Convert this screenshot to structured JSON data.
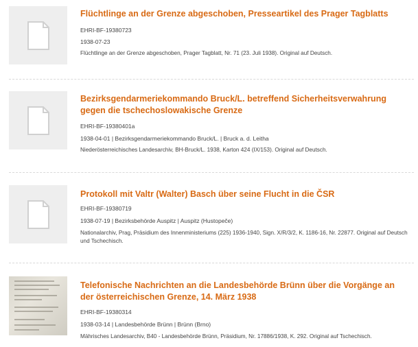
{
  "items": [
    {
      "title": "Flüchtlinge an der Grenze abgeschoben, Presseartikel des Prager Tagblatts",
      "id": "EHRI-BF-19380723",
      "meta": "1938-07-23",
      "desc": "Flüchtlinge an der Grenze abgeschoben, Prager Tagblatt, Nr. 71 (23. Juli 1938). Original auf Deutsch."
    },
    {
      "title": "Bezirksgendarmeriekommando Bruck/L. betreffend Sicherheitsverwahrung gegen die tschechoslowakische Grenze",
      "id": "EHRI-BF-19380401a",
      "meta": "1938-04-01 | Bezirksgendarmeriekommando Bruck/L. | Bruck a. d. Leitha",
      "desc": "Niederösterreichisches Landesarchiv, BH-Bruck/L. 1938, Karton 424 (IX/153). Original auf Deutsch."
    },
    {
      "title": "Protokoll mit Valtr (Walter) Basch über seine Flucht in die ČSR",
      "id": "EHRI-BF-19380719",
      "meta": "1938-07-19 | Bezirksbehörde Auspitz | Auspitz (Hustopeče)",
      "desc": "Nationalarchiv, Prag, Präsidium des Innenministeriums (225) 1936-1940, Sign. X/R/3/2, K. 1186-16, Nr. 22877. Original auf Deutsch und Tschechisch."
    },
    {
      "title": "Telefonische Nachrichten an die Landesbehörde Brünn über die Vorgänge an der österreichischen Grenze, 14. März 1938",
      "id": "EHRI-BF-19380314",
      "meta": "1938-03-14 | Landesbehörde Brünn | Brünn (Brno)",
      "desc": "Mährisches Landesarchiv, B40 - Landesbehörde Brünn, Präsidium, Nr. 17886/1938, K. 292. Original auf Tschechisch."
    }
  ],
  "icons": {
    "placeholder": "document-placeholder-icon",
    "scan": "document-scan-thumbnail"
  },
  "colors": {
    "title": "#d86a14",
    "thumb_bg": "#eeeeee",
    "text": "#444444"
  }
}
